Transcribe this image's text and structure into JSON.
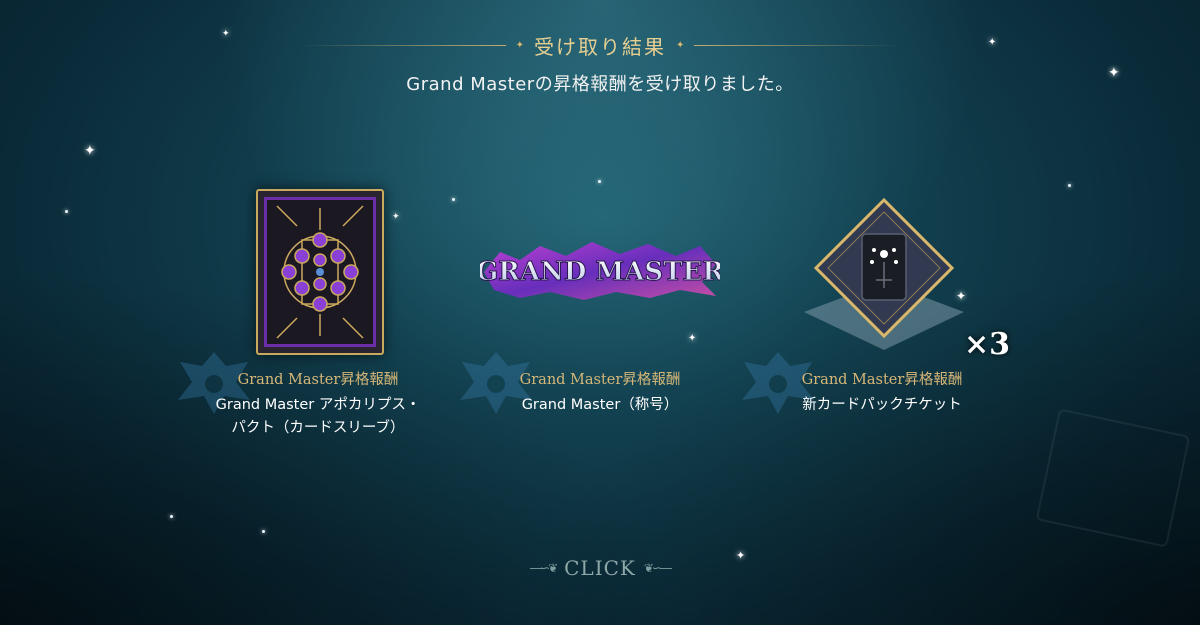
{
  "header": {
    "title": "受け取り結果"
  },
  "message": "Grand Masterの昇格報酬を受け取りました。",
  "rewards": [
    {
      "category": "Grand Master昇格報酬",
      "name_line1": "Grand Master アポカリプス・",
      "name_line2": "パクト（カードスリーブ）",
      "icon": "card-sleeve-icon"
    },
    {
      "category": "Grand Master昇格報酬",
      "name_line1": "Grand Master（称号）",
      "name_line2": "",
      "icon": "title-emblem-icon",
      "logo_text": "GRAND MASTER"
    },
    {
      "category": "Grand Master昇格報酬",
      "name_line1": "新カードパックチケット",
      "name_line2": "",
      "icon": "card-pack-ticket-icon",
      "quantity": "×3"
    }
  ],
  "footer": {
    "click_label": "CLICK"
  },
  "colors": {
    "gold": "#d6b777",
    "purple": "#6a2fa8",
    "background": "#12404f"
  }
}
